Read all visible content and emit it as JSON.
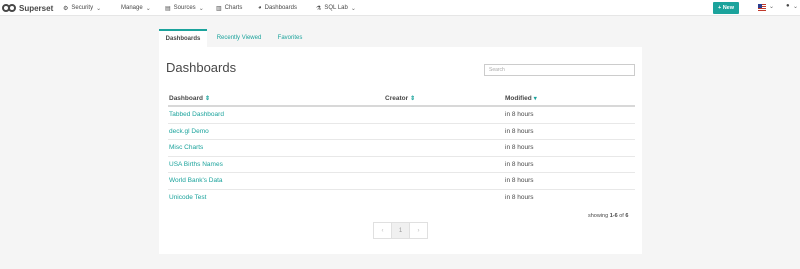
{
  "brand": {
    "name": "Superset"
  },
  "nav": {
    "security": "Security",
    "manage": "Manage",
    "sources": "Sources",
    "charts": "Charts",
    "dashboards": "Dashboards",
    "sqllab": "SQL Lab",
    "new_button": "+ New"
  },
  "tabs": [
    {
      "label": "Dashboards"
    },
    {
      "label": "Recently Viewed"
    },
    {
      "label": "Favorites"
    }
  ],
  "page": {
    "title": "Dashboards",
    "search_placeholder": "Search"
  },
  "table": {
    "columns": {
      "dashboard": "Dashboard",
      "creator": "Creator",
      "modified": "Modified"
    },
    "rows": [
      {
        "title": "Tabbed Dashboard",
        "creator": "",
        "modified": "in 8 hours"
      },
      {
        "title": "deck.gl Demo",
        "creator": "",
        "modified": "in 8 hours"
      },
      {
        "title": "Misc Charts",
        "creator": "",
        "modified": "in 8 hours"
      },
      {
        "title": "USA Births Names",
        "creator": "",
        "modified": "in 8 hours"
      },
      {
        "title": "World Bank's Data",
        "creator": "",
        "modified": "in 8 hours"
      },
      {
        "title": "Unicode Test",
        "creator": "",
        "modified": "in 8 hours"
      }
    ]
  },
  "pagination": {
    "showing_prefix": "showing",
    "range": "1-6",
    "of": "of",
    "total": "6",
    "prev": "‹",
    "current": "1",
    "next": "›"
  },
  "colors": {
    "accent": "#1ba39c",
    "text": "#484848",
    "background": "#f5f5f5"
  }
}
